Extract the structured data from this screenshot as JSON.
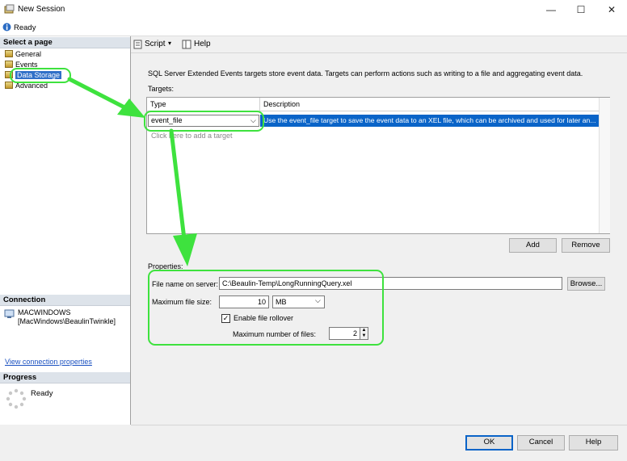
{
  "window": {
    "title": "New Session",
    "minimize": "—",
    "maximize": "☐",
    "close": "✕"
  },
  "status": {
    "text": "Ready"
  },
  "left": {
    "select_page_header": "Select a page",
    "pages": [
      {
        "label": "General"
      },
      {
        "label": "Events"
      },
      {
        "label": "Data Storage"
      },
      {
        "label": "Advanced"
      }
    ],
    "connection_header": "Connection",
    "connection_server": "MACWINDOWS",
    "connection_user": "[MacWindows\\BeaulinTwinkle]",
    "view_connection_link": "View connection properties",
    "progress_header": "Progress",
    "progress_status": "Ready"
  },
  "toolbar": {
    "script_label": "Script",
    "help_label": "Help"
  },
  "main": {
    "description": "SQL Server Extended Events targets store event data. Targets can perform actions such as writing to a file and aggregating event data.",
    "targets_label": "Targets:",
    "columns": [
      "Type",
      "Description"
    ],
    "row_type": "event_file",
    "row_description": "Use the event_file target to save the event data to an XEL file, which can be archived and used for later an...",
    "add_hint": "Click here to add a target",
    "add_button": "Add",
    "remove_button": "Remove",
    "properties_label": "Properties:",
    "file_name_label": "File name on server:",
    "file_name_value": "C:\\Beaulin-Temp\\LongRunningQuery.xel",
    "browse_button": "Browse...",
    "max_size_label": "Maximum file size:",
    "max_size_value": "10",
    "max_size_unit": "MB",
    "rollover_label": "Enable file rollover",
    "rollover_checked": "✓",
    "max_files_label": "Maximum number of files:",
    "max_files_value": "2"
  },
  "dialog_buttons": {
    "ok": "OK",
    "cancel": "Cancel",
    "help": "Help"
  },
  "colors": {
    "annotation_green": "#3ee23e",
    "selection_blue": "#0a64c8"
  }
}
